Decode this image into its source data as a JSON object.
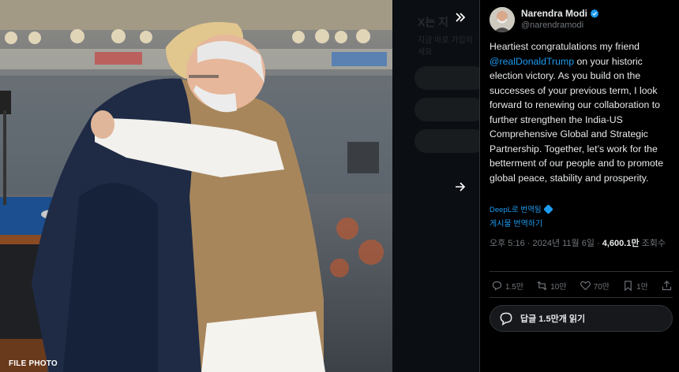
{
  "photo": {
    "caption": "FILE PHOTO"
  },
  "background_ui": {
    "heading": "X는 지",
    "subtext": "지금 바로 가입하세요"
  },
  "post": {
    "author_name": "Narendra Modi",
    "author_handle": "@narendramodi",
    "text_before": "Heartiest congratulations my friend ",
    "mention": "@realDonaldTrump",
    "text_after": " on your historic election victory. As you build on the successes of your previous term, I look forward to renewing our collaboration to further strengthen the India-US Comprehensive Global and Strategic Partnership. Together, let’s work for the betterment of our people and to promote global peace, stability and prosperity.",
    "deepl_label": "DeepL로 번역됨",
    "translate_label": "게시물 번역하기",
    "timestamp": "오후 5:16 · 2024년 11월 6일 · ",
    "views_count": "4,600.1만",
    "views_label": " 조회수",
    "replies": "1.5만",
    "reposts": "10만",
    "likes": "70만",
    "bookmarks": "1만",
    "read_replies_label": "답글 1.5만개 읽기"
  },
  "colors": {
    "accent": "#1d9bf0",
    "text": "#e7e9ea",
    "muted": "#71767b",
    "background": "#000000"
  },
  "icons": [
    "double-chevron-right-icon",
    "arrow-right-icon",
    "verified-badge-icon",
    "reply-icon",
    "repost-icon",
    "like-icon",
    "bookmark-icon",
    "share-icon",
    "chat-bubble-icon"
  ]
}
